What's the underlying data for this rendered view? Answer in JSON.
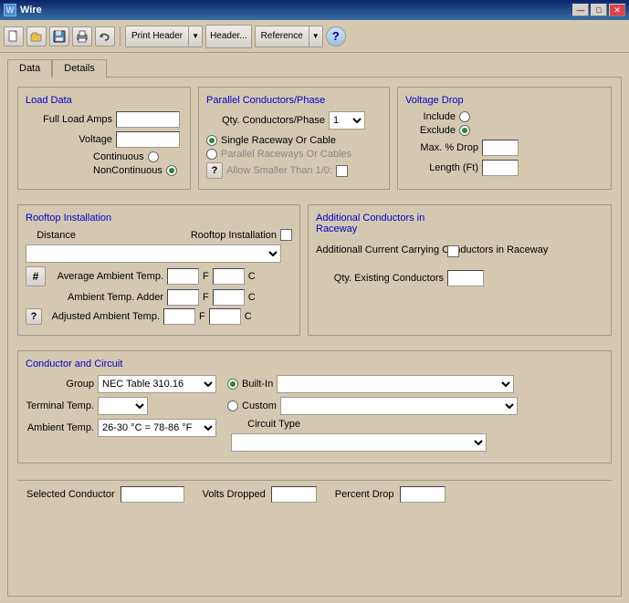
{
  "titleBar": {
    "title": "Wire",
    "minimizeLabel": "—",
    "maximizeLabel": "□",
    "closeLabel": "✕"
  },
  "toolbar": {
    "newIcon": "📄",
    "openIcon": "📂",
    "saveIcon": "💾",
    "printIcon": "🖨",
    "undoIcon": "↩",
    "printHeaderLabel": "Print Header",
    "headerLabel": "Header...",
    "referenceLabel": "Reference",
    "helpIcon": "?"
  },
  "tabs": {
    "data": "Data",
    "details": "Details"
  },
  "loadData": {
    "title": "Load Data",
    "fullLoadAmpsLabel": "Full Load Amps",
    "voltageLabel": "Voltage",
    "continuousLabel": "Continuous",
    "nonContinuousLabel": "NonContinuous"
  },
  "parallelConductors": {
    "title": "Parallel Conductors/Phase",
    "qtyConductorsLabel": "Qty. Conductors/Phase",
    "qtyConductorsValue": "1",
    "singleRacewayLabel": "Single Raceway Or Cable",
    "parallelRacewaysLabel": "Parallel Raceways Or Cables",
    "allowSmallerLabel": "Allow Smaller Than 1/0:",
    "helpIcon": "?"
  },
  "voltageDrop": {
    "title": "Voltage Drop",
    "includeLabel": "Include",
    "excludeLabel": "Exclude",
    "maxDropLabel": "Max. % Drop",
    "lengthLabel": "Length (Ft)"
  },
  "rooftopInstallation": {
    "title": "Rooftop Installation",
    "distanceLabel": "Distance",
    "rooftopInstallationLabel": "Rooftop Installation",
    "avgAmbientTempLabel": "Average Ambient Temp.",
    "ambientTempAdderLabel": "Ambient Temp. Adder",
    "adjustedAmbientTempLabel": "Adjusted Ambient Temp.",
    "fLabel": "F",
    "cLabel": "C",
    "hashIcon": "#",
    "helpIcon": "?"
  },
  "additionalConductors": {
    "title": "Additional Conductors in Raceway",
    "additionalCurrentLabel": "Additionall Current Carrying Conductors in Raceway",
    "qtyExistingLabel": "Qty. Existing Conductors"
  },
  "conductorCircuit": {
    "title": "Conductor and Circuit",
    "groupLabel": "Group",
    "groupValue": "NEC Table 310.16",
    "builtInLabel": "Built-In",
    "terminalTempLabel": "Terminal Temp.",
    "customLabel": "Custom",
    "ambientTempLabel": "Ambient Temp.",
    "ambientTempValue": "26-30 °C = 78-86 °F",
    "circuitTypeLabel": "Circuit Type"
  },
  "statusBar": {
    "selectedConductorLabel": "Selected Conductor",
    "voltsDroppedLabel": "Volts Dropped",
    "percentDropLabel": "Percent Drop"
  }
}
